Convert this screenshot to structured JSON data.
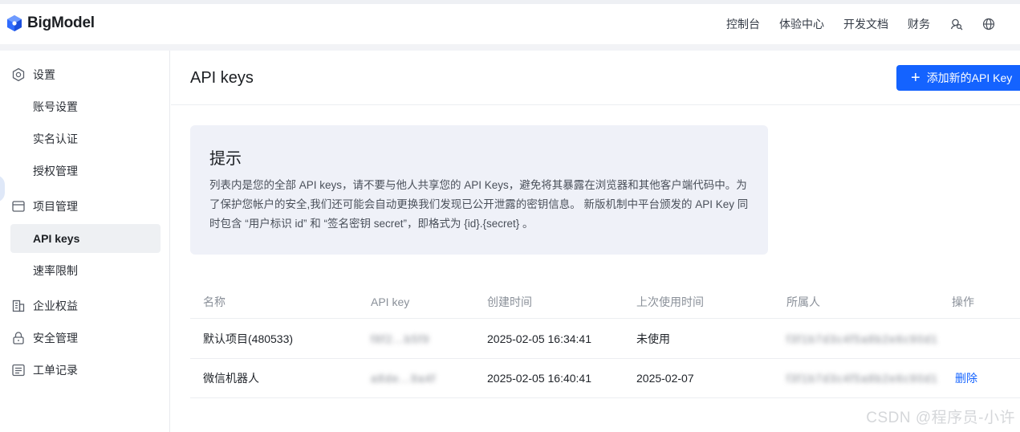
{
  "header": {
    "brand": "BigModel",
    "nav": [
      "控制台",
      "体验中心",
      "开发文档",
      "财务"
    ],
    "icons": [
      "user-search-icon",
      "globe-icon"
    ]
  },
  "sidebar": {
    "items": [
      {
        "label": "设置",
        "icon": "settings-icon"
      },
      {
        "label": "账号设置"
      },
      {
        "label": "实名认证"
      },
      {
        "label": "授权管理"
      },
      {
        "label": "项目管理",
        "icon": "project-icon"
      },
      {
        "label": "API keys",
        "active": true
      },
      {
        "label": "速率限制"
      },
      {
        "label": "企业权益",
        "icon": "building-icon"
      },
      {
        "label": "安全管理",
        "icon": "lock-icon"
      },
      {
        "label": "工单记录",
        "icon": "ticket-icon"
      }
    ]
  },
  "main": {
    "title": "API keys",
    "add_button": "添加新的API Key",
    "tip": {
      "title": "提示",
      "body": "列表内是您的全部 API keys，请不要与他人共享您的 API Keys，避免将其暴露在浏览器和其他客户端代码中。为了保护您帐户的安全,我们还可能会自动更换我们发现已公开泄露的密钥信息。 新版机制中平台颁发的 API Key 同时包含 “用户标识 id” 和 “签名密钥 secret”，即格式为 {id}.{secret} 。"
    },
    "table": {
      "headers": [
        "名称",
        "API key",
        "创建时间",
        "上次使用时间",
        "所属人",
        "操作"
      ],
      "rows": [
        {
          "name": "默认项目(480533)",
          "key": "f8f2...b5f9",
          "created": "2025-02-05 16:34:41",
          "last_used": "未使用",
          "owner": "f3f1b7d3c4f5a8b2e6c90d1",
          "action": ""
        },
        {
          "name": "微信机器人",
          "key": "a8de...9a4f",
          "created": "2025-02-05 16:40:41",
          "last_used": "2025-02-07",
          "owner": "f3f1b7d3c4f5a8b2e6c90d1",
          "action": "删除"
        }
      ]
    }
  },
  "watermark": "CSDN @程序员-小许",
  "colors": {
    "primary": "#1463ff",
    "tip_bg": "#eff1f8",
    "active_bg": "#eef0f3"
  }
}
